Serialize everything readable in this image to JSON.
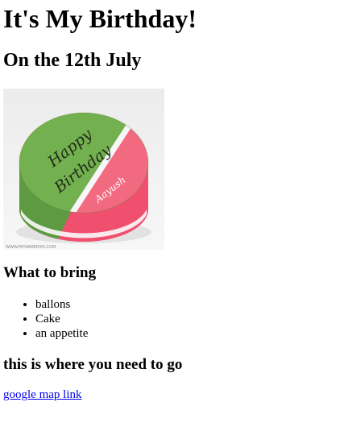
{
  "page": {
    "title": "It's My Birthday!",
    "subtitle": "On the 12th July"
  },
  "cake_image": {
    "icon": "birthday-cake-photo",
    "cake_text_line1": "Happy",
    "cake_text_line2": "Birthday",
    "cake_name": "Aayush",
    "watermark": "WWW.MYNAMEPIXS.COM",
    "colors": {
      "green_top": "#6aa84f",
      "red_side": "#f0506e",
      "background": "#f4f4f4"
    }
  },
  "bring": {
    "heading": "What to bring",
    "items": [
      "ballons",
      "Cake",
      "an appetite"
    ]
  },
  "location": {
    "heading": "this is where you need to go",
    "link_text": "google map link",
    "link_color": "#0000ee"
  }
}
